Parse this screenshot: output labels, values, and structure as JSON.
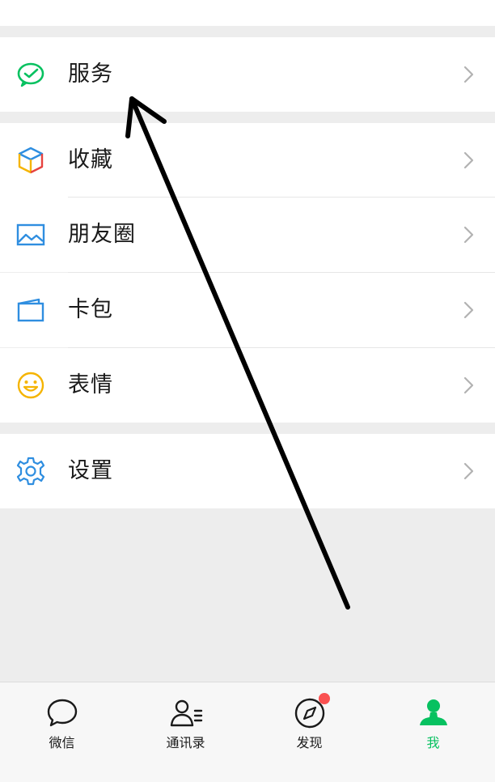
{
  "colors": {
    "accent": "#07c160",
    "badge": "#fa5151",
    "background": "#ededed"
  },
  "menu": {
    "services": {
      "label": "服务",
      "icon": "services-icon"
    },
    "favorites": {
      "label": "收藏",
      "icon": "cube-icon"
    },
    "moments": {
      "label": "朋友圈",
      "icon": "image-icon"
    },
    "cards": {
      "label": "卡包",
      "icon": "wallet-icon"
    },
    "stickers": {
      "label": "表情",
      "icon": "smiley-icon"
    },
    "settings": {
      "label": "设置",
      "icon": "gear-icon"
    }
  },
  "tabbar": {
    "tabs": [
      {
        "label": "微信",
        "icon": "chat-bubble-icon",
        "active": false
      },
      {
        "label": "通讯录",
        "icon": "contacts-icon",
        "active": false
      },
      {
        "label": "发现",
        "icon": "compass-icon",
        "active": false,
        "badge": "dot"
      },
      {
        "label": "我",
        "icon": "person-icon",
        "active": true
      }
    ]
  }
}
